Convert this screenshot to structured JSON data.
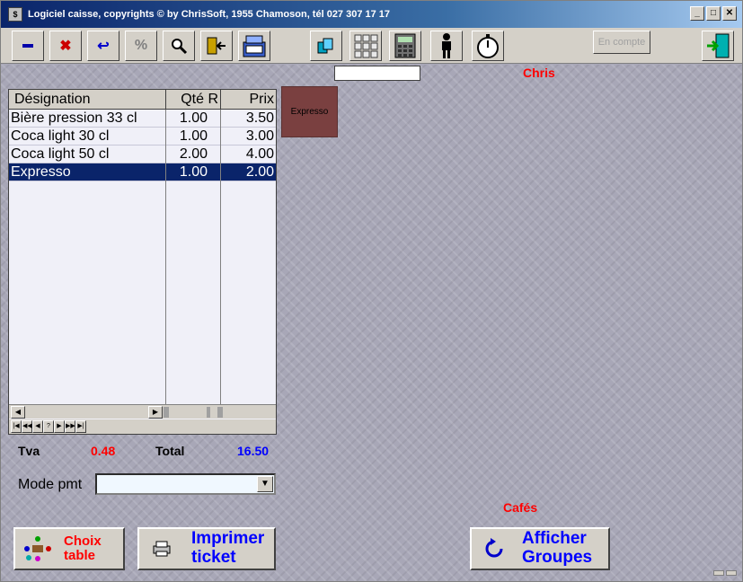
{
  "window": {
    "title": "Logiciel caisse, copyrights © by ChrisSoft, 1955 Chamoson, tél 027 307 17 17"
  },
  "toolbar": {
    "en_compte_label": "En compte"
  },
  "user": {
    "name": "Chris"
  },
  "grid": {
    "columns": [
      "Désignation",
      "Qté R",
      "Prix"
    ],
    "rows": [
      {
        "designation": "Bière pression 33 cl",
        "qty": "1.00",
        "price": "3.50"
      },
      {
        "designation": "Coca light 30 cl",
        "qty": "1.00",
        "price": "3.00"
      },
      {
        "designation": "Coca light 50 cl",
        "qty": "2.00",
        "price": "4.00"
      },
      {
        "designation": "Expresso",
        "qty": "1.00",
        "price": "2.00"
      }
    ],
    "selected_row": 3
  },
  "product_tile": {
    "label": "Expresso",
    "color": "#7a4040"
  },
  "totals": {
    "tva_label": "Tva",
    "tva_value": "0.48",
    "total_label": "Total",
    "total_value": "16.50"
  },
  "payment": {
    "label": "Mode pmt",
    "value": ""
  },
  "group": {
    "name": "Cafés"
  },
  "buttons": {
    "choix_table": [
      "Choix",
      "table"
    ],
    "imprimer_ticket": [
      "Imprimer",
      "ticket"
    ],
    "afficher_groupes": [
      "Afficher",
      "Groupes"
    ]
  }
}
